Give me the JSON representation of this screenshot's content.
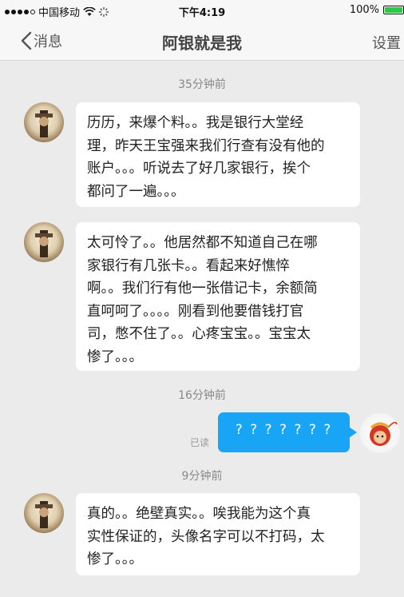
{
  "status_bar": {
    "carrier": "中国移动",
    "time": "下午4:19",
    "battery_text": "100%",
    "battery_level": 1.0,
    "signal_dots_filled": 4,
    "signal_dots_total": 5,
    "icons": [
      "wifi-icon",
      "activity-icon",
      "battery-icon"
    ]
  },
  "nav": {
    "back_label": "消息",
    "title": "阿银就是我",
    "settings_label": "设置"
  },
  "messages": [
    {
      "type": "time",
      "text": "35分钟前"
    },
    {
      "type": "in",
      "text": "历历，来爆个料。。我是银行大堂经\n理，昨天王宝强来我们行查有没有他的\n账户。。。听说去了好几家银行，挨个\n都问了一遍。。。"
    },
    {
      "type": "in",
      "text": "太可怜了。。他居然都不知道自己在哪\n家银行有几张卡。。看起来好憔悴\n啊。。我们行有他一张借记卡，余额简\n直呵呵了。。。。刚看到他要借钱打官\n司，憋不住了。。心疼宝宝。。宝宝太\n惨了。。。"
    },
    {
      "type": "time",
      "text": "16分钟前"
    },
    {
      "type": "out",
      "text": "? ? ? ? ? ? ?",
      "read_label": "已读"
    },
    {
      "type": "time",
      "text": "9分钟前"
    },
    {
      "type": "in",
      "text": "真的。。绝壁真实。。唉我能为这个真\n实性保证的，头像名字可以不打码，太\n惨了。。。"
    }
  ],
  "colors": {
    "background": "#ebebeb",
    "outgoing_bubble": "#19a5f6",
    "incoming_bubble": "#ffffff",
    "battery": "#2cc84a"
  }
}
